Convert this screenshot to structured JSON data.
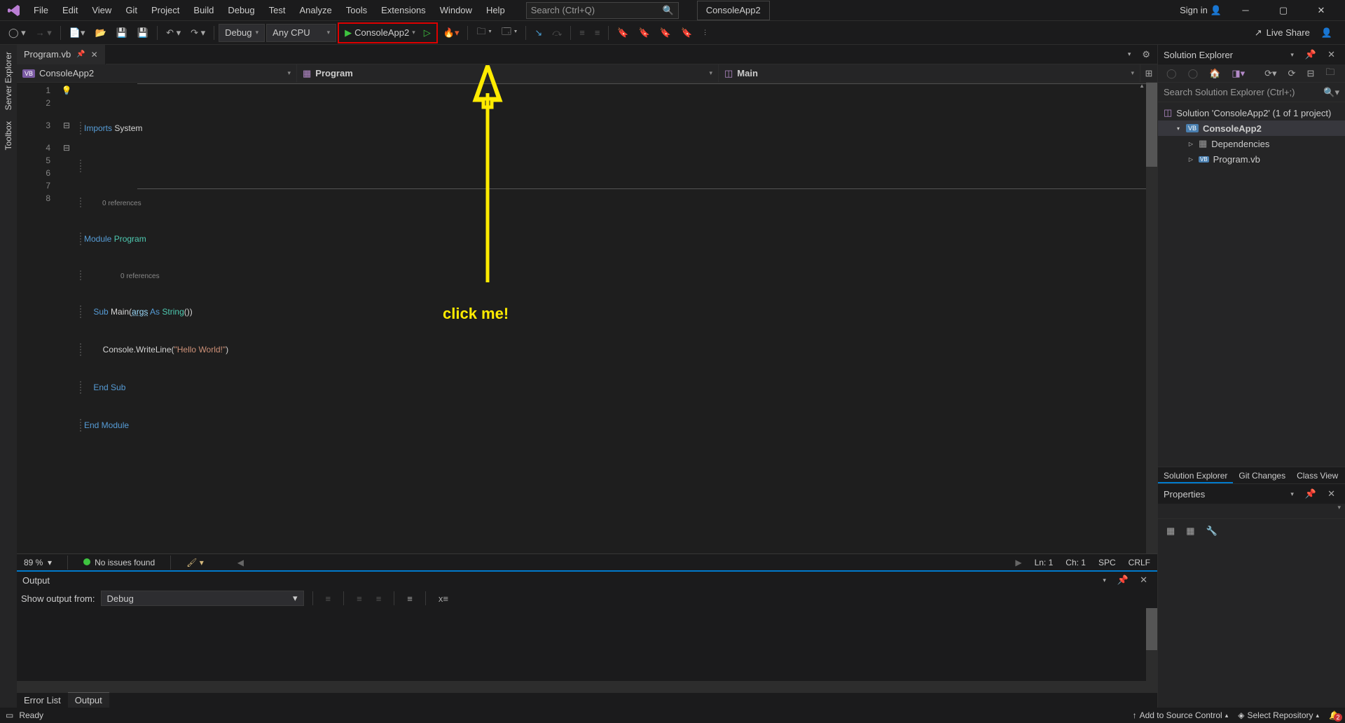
{
  "menubar": {
    "items": [
      "File",
      "Edit",
      "View",
      "Git",
      "Project",
      "Build",
      "Debug",
      "Test",
      "Analyze",
      "Tools",
      "Extensions",
      "Window",
      "Help"
    ],
    "searchPlaceholder": "Search (Ctrl+Q)",
    "projectName": "ConsoleApp2",
    "signIn": "Sign in"
  },
  "toolbar": {
    "config": "Debug",
    "platform": "Any CPU",
    "runTarget": "ConsoleApp2",
    "liveShare": "Live Share"
  },
  "verticalTabs": [
    "Server Explorer",
    "Toolbox"
  ],
  "docTabs": {
    "active": "Program.vb"
  },
  "navCombos": {
    "project": "ConsoleApp2",
    "type": "Program",
    "member": "Main"
  },
  "code": {
    "refs0": "0 references",
    "refs1": "0 references",
    "l1a": "Imports",
    "l1b": " System",
    "l3a": "Module",
    "l3b": " Program",
    "l4a": "    Sub",
    "l4b": " Main",
    "l4c": "(",
    "l4d": "args",
    "l4e": " As ",
    "l4f": "String",
    "l4g": "())",
    "l5a": "        Console",
    "l5b": ".WriteLine(",
    "l5c": "\"Hello World!\"",
    "l5d": ")",
    "l6a": "    End Sub",
    "l7a": "End Module"
  },
  "editorStatus": {
    "zoom": "89 %",
    "issues": "No issues found",
    "ln": "Ln: 1",
    "ch": "Ch: 1",
    "spaces": "SPC",
    "eol": "CRLF"
  },
  "output": {
    "title": "Output",
    "fromLabel": "Show output from:",
    "fromValue": "Debug"
  },
  "bottomTabs": {
    "errorList": "Error List",
    "output": "Output"
  },
  "solutionExplorer": {
    "title": "Solution Explorer",
    "searchPlaceholder": "Search Solution Explorer (Ctrl+;)",
    "solution": "Solution 'ConsoleApp2' (1 of 1 project)",
    "project": "ConsoleApp2",
    "deps": "Dependencies",
    "program": "Program.vb"
  },
  "panelTabs": {
    "se": "Solution Explorer",
    "git": "Git Changes",
    "cv": "Class View"
  },
  "properties": {
    "title": "Properties"
  },
  "statusbar": {
    "ready": "Ready",
    "addSC": "Add to Source Control",
    "selectRepo": "Select Repository",
    "bellCount": "2"
  },
  "annotation": {
    "text": "click me!"
  }
}
